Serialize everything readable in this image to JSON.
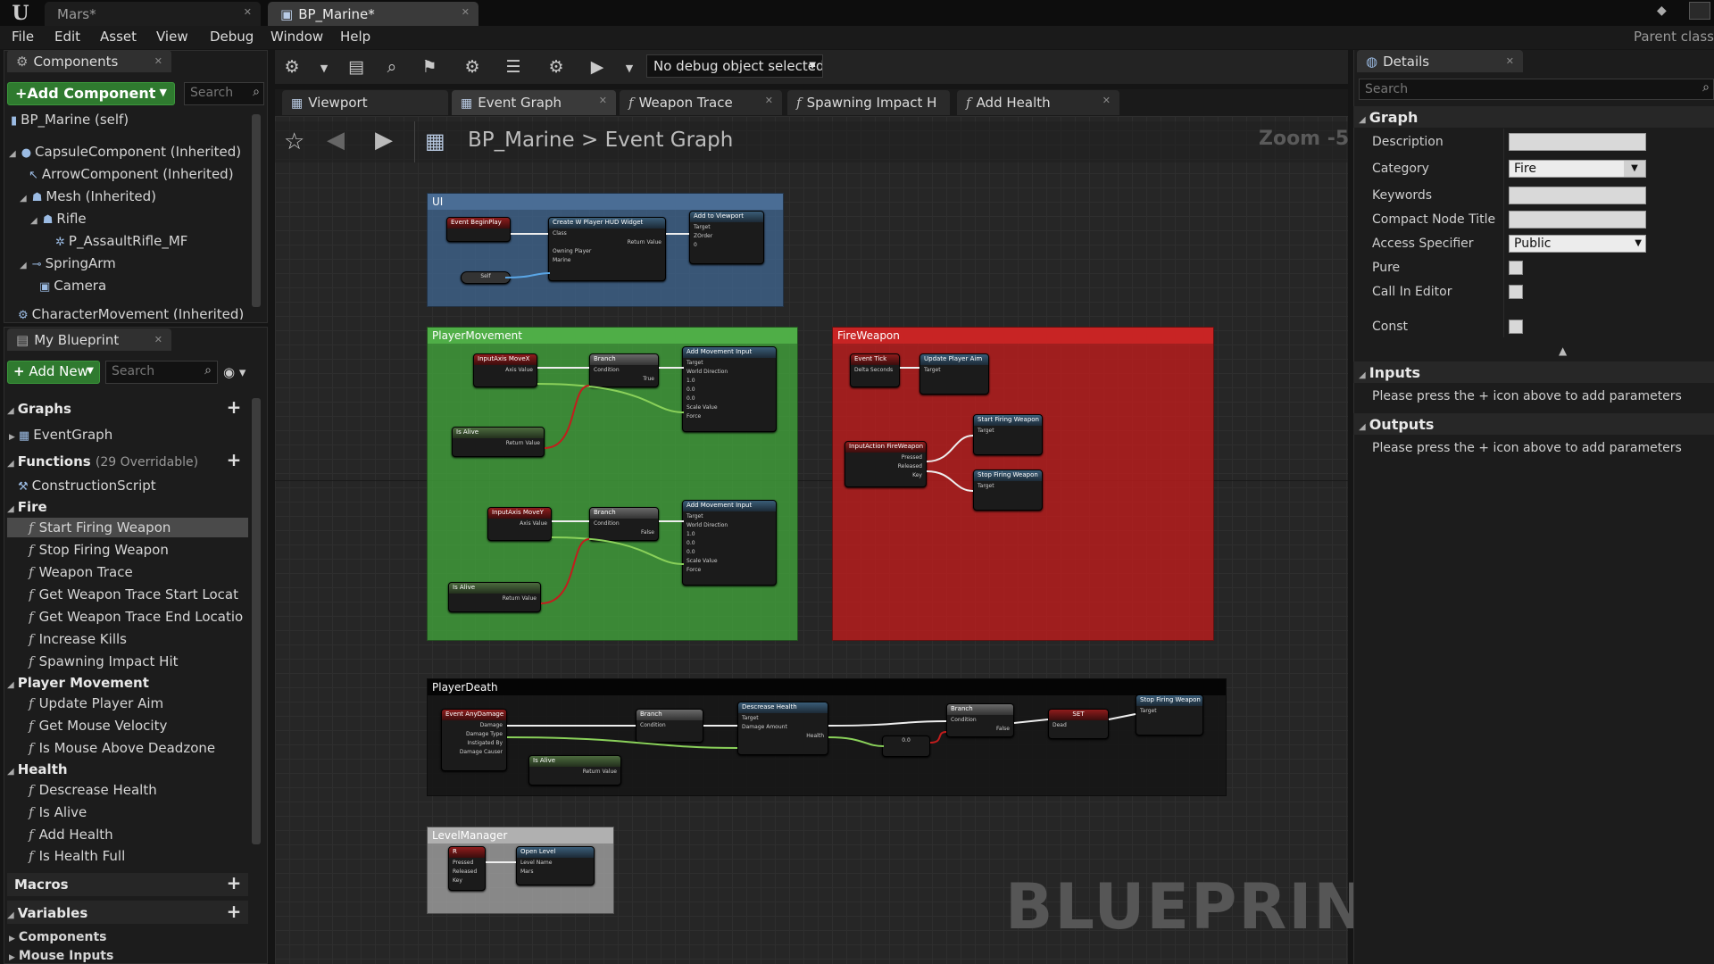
{
  "doc_tabs": [
    "Mars*",
    "BP_Marine*"
  ],
  "parent_class": "Parent class",
  "menu": [
    "File",
    "Edit",
    "Asset",
    "View",
    "Debug",
    "Window",
    "Help"
  ],
  "components": {
    "tab": "Components",
    "add_button": "+Add Component",
    "search_placeholder": "Search",
    "self": "BP_Marine (self)",
    "items": [
      "CapsuleComponent (Inherited)",
      "ArrowComponent (Inherited)",
      "Mesh (Inherited)",
      "Rifle",
      "P_AssaultRifle_MF",
      "SpringArm",
      "Camera",
      "CharacterMovement (Inherited)"
    ]
  },
  "my_blueprint": {
    "tab": "My Blueprint",
    "add_button": "Add New",
    "search_placeholder": "Search",
    "graphs_header": "Graphs",
    "event_graph": "EventGraph",
    "functions_header": "Functions",
    "functions_overridable": "(29 Overridable)",
    "construction_script": "ConstructionScript",
    "categories": {
      "fire": "Fire",
      "player_movement": "Player Movement",
      "health": "Health"
    },
    "fire_functions": [
      "Start Firing Weapon",
      "Stop Firing Weapon",
      "Weapon Trace",
      "Get Weapon Trace Start Locat",
      "Get Weapon Trace End Locatio",
      "Increase Kills",
      "Spawning Impact Hit"
    ],
    "player_movement_functions": [
      "Update Player Aim",
      "Get Mouse Velocity",
      "Is Mouse Above Deadzone"
    ],
    "health_functions": [
      "Descrease Health",
      "Is Alive",
      "Add Health",
      "Is Health Full"
    ],
    "macros_header": "Macros",
    "variables_header": "Variables",
    "variable_groups": [
      "Components",
      "Mouse Inputs"
    ]
  },
  "toolbar": {
    "debug_select": "No debug object selected"
  },
  "graph_tabs": [
    "Viewport",
    "Event Graph",
    "Weapon Trace",
    "Spawning Impact H",
    "Add Health"
  ],
  "graph": {
    "breadcrumb_root": "BP_Marine",
    "breadcrumb_sep": ">",
    "breadcrumb_leaf": "Event Graph",
    "zoom": "Zoom -5",
    "watermark": "BLUEPRINT",
    "comments": {
      "ui": "UI",
      "player_movement": "PlayerMovement",
      "fire_weapon": "FireWeapon",
      "player_death": "PlayerDeath",
      "level_manager": "LevelManager"
    },
    "nodes": {
      "event_begin_play": "Event BeginPlay",
      "create_widget": "Create W Player HUD Widget",
      "add_to_viewport": "Add to Viewport",
      "self": "Self",
      "input_axis_x": "InputAxis MoveX",
      "branch": "Branch",
      "add_movement_input": "Add Movement Input",
      "is_alive": "Is Alive",
      "input_axis_y": "InputAxis MoveY",
      "event_tick": "Event Tick",
      "update_player_aim": "Update Player Aim",
      "input_action_fire": "InputAction FireWeapon",
      "start_firing": "Start Firing Weapon",
      "stop_firing": "Stop Firing Weapon",
      "event_any_damage": "Event AnyDamage",
      "decrease_health": "Descrease Health",
      "set": "SET",
      "r_key": "R",
      "open_level": "Open Level"
    },
    "pins": {
      "axis_value": "Axis Value",
      "condition": "Condition",
      "true": "True",
      "false": "False",
      "target": "Target",
      "world_direction": "World Direction",
      "scale_value": "Scale Value",
      "force": "Force",
      "return_value": "Return Value",
      "class": "Class",
      "owning_player": "Owning Player",
      "marine": "Marine",
      "zorder": "ZOrder",
      "delta_seconds": "Delta Seconds",
      "pressed": "Pressed",
      "released": "Released",
      "key": "Key",
      "damage": "Damage",
      "damage_type": "Damage Type",
      "instigated_by": "Instigated By",
      "damage_causer": "Damage Causer",
      "damage_amount": "Damage Amount",
      "health": "Health",
      "dead": "Dead",
      "level_name": "Level Name",
      "self_pin": "self",
      "dir_x": "1.0",
      "dir_y": "0.0",
      "dir_z": "0.0",
      "zorder_value": "0",
      "compare_value": "0.0",
      "level_value": "Mars"
    }
  },
  "details": {
    "tab": "Details",
    "search_placeholder": "Search",
    "graph_header": "Graph",
    "description_label": "Description",
    "category_label": "Category",
    "category_value": "Fire",
    "keywords_label": "Keywords",
    "compact_node_title_label": "Compact Node Title",
    "access_specifier_label": "Access Specifier",
    "access_specifier_value": "Public",
    "pure_label": "Pure",
    "call_in_editor_label": "Call In Editor",
    "const_label": "Const",
    "inputs_header": "Inputs",
    "inputs_note": "Please press the + icon above to add parameters",
    "outputs_header": "Outputs",
    "outputs_note": "Please press the + icon above to add parameters"
  },
  "colors": {
    "ui_comment": "#3d5f85",
    "player_movement_comment": "#3f9a3a",
    "fire_weapon_comment": "#b51d1d",
    "player_death_comment": "#161616",
    "level_manager_comment": "#9a9a9a",
    "add_button_green": "#2f7a2f"
  },
  "icons": {
    "app_logo": "unreal-logo",
    "favorite": "star-icon",
    "back": "arrow-left-icon",
    "forward": "arrow-right-icon",
    "graph": "graph-icon",
    "play": "play-icon",
    "function": "function-icon"
  }
}
